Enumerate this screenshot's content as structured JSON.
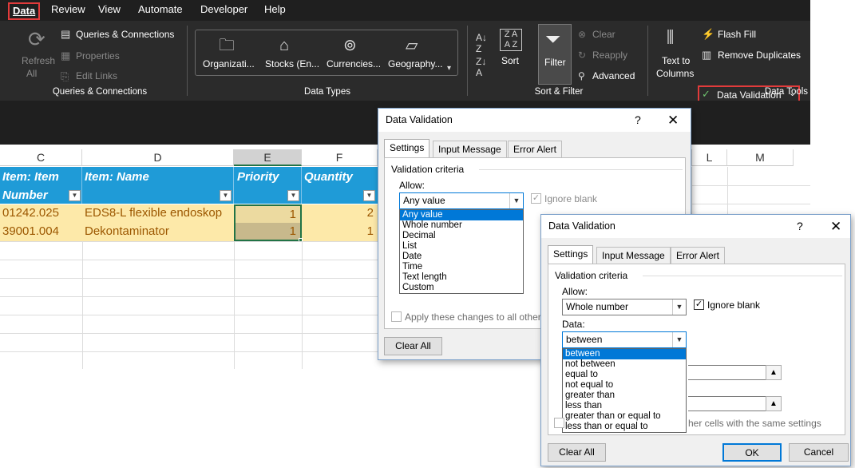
{
  "ribbon": {
    "tabs": [
      "Data",
      "Review",
      "View",
      "Automate",
      "Developer",
      "Help"
    ],
    "groups": {
      "queries": {
        "refresh_label": "Refresh",
        "refresh_sub": "All",
        "queries_connections": "Queries & Connections",
        "properties": "Properties",
        "edit_links": "Edit Links",
        "group_label": "Queries & Connections"
      },
      "data_types": {
        "items": [
          "Organizati...",
          "Stocks (En...",
          "Currencies...",
          "Geography..."
        ],
        "group_label": "Data Types"
      },
      "sort_filter": {
        "sort": "Sort",
        "filter": "Filter",
        "clear": "Clear",
        "reapply": "Reapply",
        "advanced": "Advanced",
        "group_label": "Sort & Filter"
      },
      "data_tools": {
        "text_to_columns_1": "Text to",
        "text_to_columns_2": "Columns",
        "flash_fill": "Flash Fill",
        "remove_duplicates": "Remove Duplicates",
        "data_validation": "Data Validation",
        "group_label": "Data Tools"
      }
    }
  },
  "sheet": {
    "columns": [
      "C",
      "D",
      "E",
      "F",
      "L",
      "M"
    ],
    "headers": {
      "c_line1": "Item: Item",
      "c_line2": "Number",
      "d": "Item: Name",
      "e": "Priority",
      "f": "Quantity"
    },
    "rows": [
      {
        "number": "01242.025",
        "name": "EDS8-L flexible endoskop",
        "priority": "1",
        "quantity": "2"
      },
      {
        "number": "39001.004",
        "name": "Dekontaminator",
        "priority": "1",
        "quantity": "1"
      }
    ]
  },
  "dialog1": {
    "title": "Data Validation",
    "help": "?",
    "tabs": [
      "Settings",
      "Input Message",
      "Error Alert"
    ],
    "section": "Validation criteria",
    "allow_label": "Allow:",
    "allow_value": "Any value",
    "ignore_blank": "Ignore blank",
    "options": [
      "Any value",
      "Whole number",
      "Decimal",
      "List",
      "Date",
      "Time",
      "Text length",
      "Custom"
    ],
    "apply_text": "Apply these changes to all other c",
    "clear_all": "Clear All"
  },
  "dialog2": {
    "title": "Data Validation",
    "help": "?",
    "tabs": [
      "Settings",
      "Input Message",
      "Error Alert"
    ],
    "section": "Validation criteria",
    "allow_label": "Allow:",
    "allow_value": "Whole number",
    "ignore_blank": "Ignore blank",
    "data_label": "Data:",
    "data_value": "between",
    "options": [
      "between",
      "not between",
      "equal to",
      "not equal to",
      "greater than",
      "less than",
      "greater than or equal to",
      "less than or equal to"
    ],
    "apply_text_tail": "her cells with the same settings",
    "clear_all": "Clear All",
    "ok": "OK",
    "cancel": "Cancel"
  }
}
